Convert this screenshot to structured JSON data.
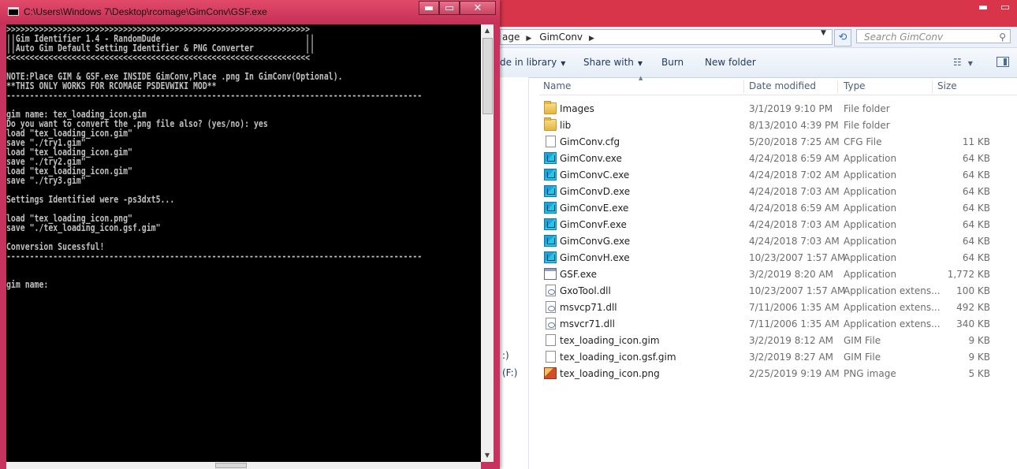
{
  "console": {
    "title": "C:\\Users\\Windows 7\\Desktop\\rcomage\\GimConv\\GSF.exe",
    "buttons": {
      "minimize": "▬",
      "maximize": "▭",
      "close": "✕"
    },
    "lines": [
      ">>>>>>>>>>>>>>>>>>>>>>>>>>>>>>>>>>>>>>>>>>>>>>>>>>>>>>>>>>>>>>>>>",
      "||Gim Identifier 1.4 - RandomDude                               ||",
      "||Auto Gim Default Setting Identifier & PNG Converter           ||",
      "<<<<<<<<<<<<<<<<<<<<<<<<<<<<<<<<<<<<<<<<<<<<<<<<<<<<<<<<<<<<<<<<<",
      "",
      "NOTE:Place GIM & GSF.exe INSIDE GimConv,Place .png In GimConv(Optional).",
      "**THIS ONLY WORKS FOR RCOMAGE PSDEVWIKI MOD**",
      "-----------------------------------------------------------------------------------------",
      "",
      "gim name: tex_loading_icon.gim",
      "Do you want to convert the .png file also? (yes/no): yes",
      "load \"tex_loading_icon.gim\"",
      "save \"./try1.gim\"",
      "load \"tex_loading_icon.gim\"",
      "save \"./try2.gim\"",
      "load \"tex_loading_icon.gim\"",
      "save \"./try3.gim\"",
      "",
      "Settings Identified were -ps3dxt5...",
      "",
      "load \"tex_loading_icon.png\"",
      "save \"./tex_loading_icon.gsf.gim\"",
      "",
      "Conversion Sucessful!",
      "-----------------------------------------------------------------------------------------",
      "",
      "",
      "gim name:"
    ]
  },
  "explorer": {
    "address": {
      "crumbs": [
        "age",
        "GimConv"
      ]
    },
    "search_placeholder": "Search GimConv",
    "toolbar": {
      "include": "de in library",
      "share": "Share with",
      "burn": "Burn",
      "new_folder": "New folder"
    },
    "nav": {
      "drive_1": ":)",
      "drive_2": "(F:)"
    },
    "columns": {
      "name": "Name",
      "date": "Date modified",
      "type": "Type",
      "size": "Size"
    },
    "files": [
      {
        "name": "Images",
        "date": "3/1/2019 9:10 PM",
        "type": "File folder",
        "size": "",
        "icon": "folder-icon"
      },
      {
        "name": "lib",
        "date": "8/13/2010 4:39 PM",
        "type": "File folder",
        "size": "",
        "icon": "folder-icon"
      },
      {
        "name": "GimConv.cfg",
        "date": "5/20/2018 7:25 AM",
        "type": "CFG File",
        "size": "11 KB",
        "icon": "cfg-file-icon"
      },
      {
        "name": "GimConv.exe",
        "date": "4/24/2018 6:59 AM",
        "type": "Application",
        "size": "64 KB",
        "icon": "gimconv-app-icon"
      },
      {
        "name": "GimConvC.exe",
        "date": "4/24/2018 7:02 AM",
        "type": "Application",
        "size": "64 KB",
        "icon": "gimconv-app-icon"
      },
      {
        "name": "GimConvD.exe",
        "date": "4/24/2018 7:03 AM",
        "type": "Application",
        "size": "64 KB",
        "icon": "gimconv-app-icon"
      },
      {
        "name": "GimConvE.exe",
        "date": "4/24/2018 6:59 AM",
        "type": "Application",
        "size": "64 KB",
        "icon": "gimconv-app-icon"
      },
      {
        "name": "GimConvF.exe",
        "date": "4/24/2018 7:03 AM",
        "type": "Application",
        "size": "64 KB",
        "icon": "gimconv-app-icon"
      },
      {
        "name": "GimConvG.exe",
        "date": "4/24/2018 7:03 AM",
        "type": "Application",
        "size": "64 KB",
        "icon": "gimconv-app-icon"
      },
      {
        "name": "GimConvH.exe",
        "date": "10/23/2007 1:57 AM",
        "type": "Application",
        "size": "64 KB",
        "icon": "gimconv-app-icon"
      },
      {
        "name": "GSF.exe",
        "date": "3/2/2019 8:20 AM",
        "type": "Application",
        "size": "1,772 KB",
        "icon": "console-app-icon"
      },
      {
        "name": "GxoTool.dll",
        "date": "10/23/2007 1:57 AM",
        "type": "Application extens...",
        "size": "100 KB",
        "icon": "dll-icon"
      },
      {
        "name": "msvcp71.dll",
        "date": "7/11/2006 1:35 AM",
        "type": "Application extens...",
        "size": "492 KB",
        "icon": "dll-icon"
      },
      {
        "name": "msvcr71.dll",
        "date": "7/11/2006 1:35 AM",
        "type": "Application extens...",
        "size": "340 KB",
        "icon": "dll-icon"
      },
      {
        "name": "tex_loading_icon.gim",
        "date": "3/2/2019 8:12 AM",
        "type": "GIM File",
        "size": "9 KB",
        "icon": "file-icon"
      },
      {
        "name": "tex_loading_icon.gsf.gim",
        "date": "3/2/2019 8:27 AM",
        "type": "GIM File",
        "size": "9 KB",
        "icon": "file-icon"
      },
      {
        "name": "tex_loading_icon.png",
        "date": "2/25/2019 9:19 AM",
        "type": "PNG image",
        "size": "5 KB",
        "icon": "png-image-icon"
      }
    ]
  }
}
